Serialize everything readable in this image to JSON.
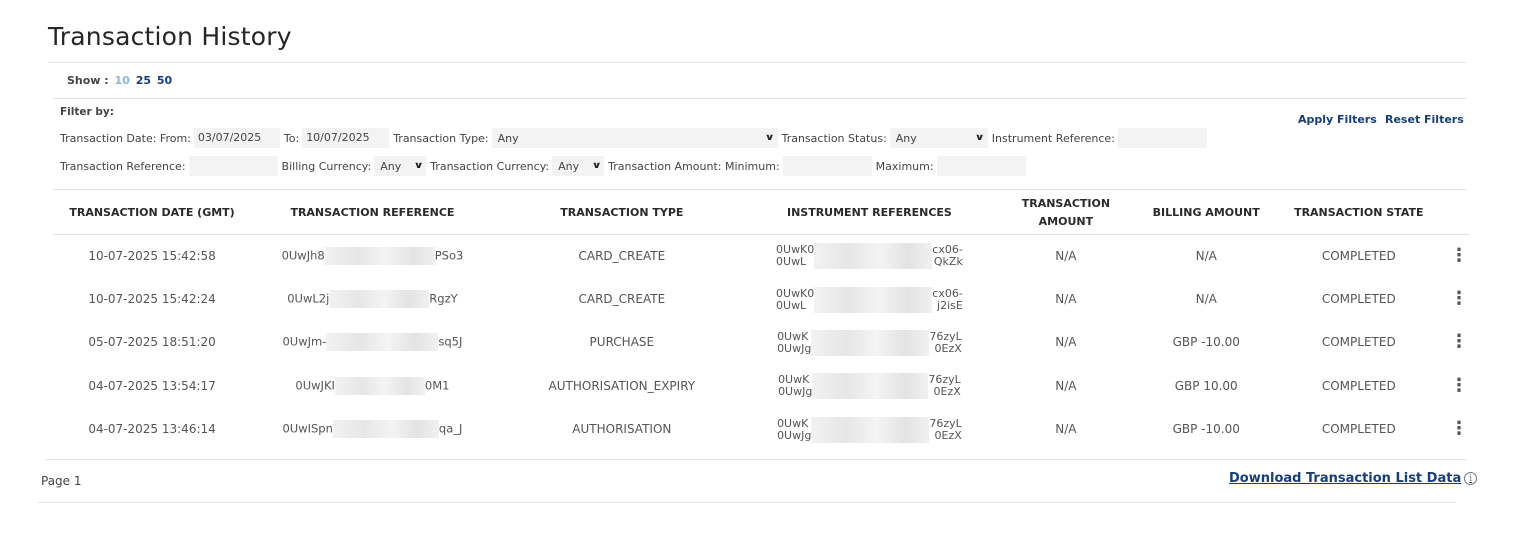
{
  "page_title": "Transaction History",
  "show": {
    "label": "Show :",
    "options": [
      "10",
      "25",
      "50"
    ],
    "active": "10"
  },
  "filters": {
    "label": "Filter by:",
    "date_from_label": "Transaction Date: From:",
    "date_from": "03/07/2025",
    "date_to_label": "To:",
    "date_to": "10/07/2025",
    "type_label": "Transaction Type:",
    "type_value": "Any",
    "status_label": "Transaction Status:",
    "status_value": "Any",
    "instrument_ref_label": "Instrument Reference:",
    "instrument_ref_value": "",
    "txn_ref_label": "Transaction Reference:",
    "txn_ref_value": "",
    "billing_currency_label": "Billing Currency:",
    "billing_currency_value": "Any",
    "txn_currency_label": "Transaction Currency:",
    "txn_currency_value": "Any",
    "amount_min_label": "Transaction Amount: Minimum:",
    "amount_min_value": "",
    "amount_max_label": "Maximum:",
    "amount_max_value": "",
    "apply_label": "Apply Filters",
    "reset_label": "Reset Filters"
  },
  "table": {
    "headers": [
      "TRANSACTION DATE (GMT)",
      "TRANSACTION REFERENCE",
      "TRANSACTION TYPE",
      "INSTRUMENT REFERENCES",
      "TRANSACTION AMOUNT",
      "BILLING AMOUNT",
      "TRANSACTION STATE"
    ],
    "rows": [
      {
        "date": "10-07-2025 15:42:58",
        "ref_start": "0UwJh8",
        "ref_end": "PSo3",
        "type": "CARD_CREATE",
        "instr1_start": "0UwK0",
        "instr1_end": "cx06-",
        "instr2_start": "0UwL",
        "instr2_end": "QkZk",
        "amount": "N/A",
        "billing": "N/A",
        "state": "COMPLETED"
      },
      {
        "date": "10-07-2025 15:42:24",
        "ref_start": "0UwL2j",
        "ref_end": "RgzY",
        "type": "CARD_CREATE",
        "instr1_start": "0UwK0",
        "instr1_end": "cx06-",
        "instr2_start": "0UwL",
        "instr2_end": "j2isE",
        "amount": "N/A",
        "billing": "N/A",
        "state": "COMPLETED"
      },
      {
        "date": "05-07-2025 18:51:20",
        "ref_start": "0UwJm-",
        "ref_end": "sq5J",
        "type": "PURCHASE",
        "instr1_start": "0UwK",
        "instr1_end": "76zyL",
        "instr2_start": "0UwJg",
        "instr2_end": "0EzX",
        "amount": "N/A",
        "billing": "GBP -10.00",
        "state": "COMPLETED"
      },
      {
        "date": "04-07-2025 13:54:17",
        "ref_start": "0UwJKI",
        "ref_end": "0M1",
        "type": "AUTHORISATION_EXPIRY",
        "instr1_start": "0UwK",
        "instr1_end": "76zyL",
        "instr2_start": "0UwJg",
        "instr2_end": "0EzX",
        "amount": "N/A",
        "billing": "GBP 10.00",
        "state": "COMPLETED"
      },
      {
        "date": "04-07-2025 13:46:14",
        "ref_start": "0UwISpn",
        "ref_end": "qa_J",
        "type": "AUTHORISATION",
        "instr1_start": "0UwK",
        "instr1_end": "76zyL",
        "instr2_start": "0UwJg",
        "instr2_end": "0EzX",
        "amount": "N/A",
        "billing": "GBP -10.00",
        "state": "COMPLETED"
      }
    ]
  },
  "footer": {
    "page_label": "Page 1",
    "download_label": "Download Transaction List Data",
    "info_icon": "i"
  },
  "colors": {
    "link": "#163f7a",
    "active_page_size": "#8fb6d8"
  }
}
